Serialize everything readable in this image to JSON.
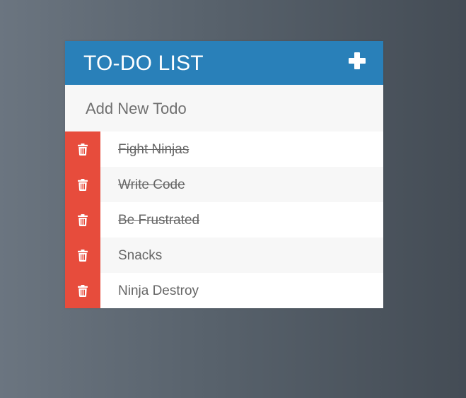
{
  "header": {
    "title": "TO-DO LIST",
    "add_icon": "plus-icon"
  },
  "new_todo": {
    "placeholder": "Add New Todo",
    "value": ""
  },
  "items": [
    {
      "text": "Fight Ninjas",
      "completed": true
    },
    {
      "text": "Write Code",
      "completed": true
    },
    {
      "text": "Be Frustrated",
      "completed": true
    },
    {
      "text": "Snacks",
      "completed": false
    },
    {
      "text": "Ninja Destroy",
      "completed": false
    }
  ],
  "colors": {
    "header": "#2980b9",
    "delete": "#e74c3c",
    "row_alt": "#f7f7f7"
  },
  "delete_icon": "trash-icon"
}
